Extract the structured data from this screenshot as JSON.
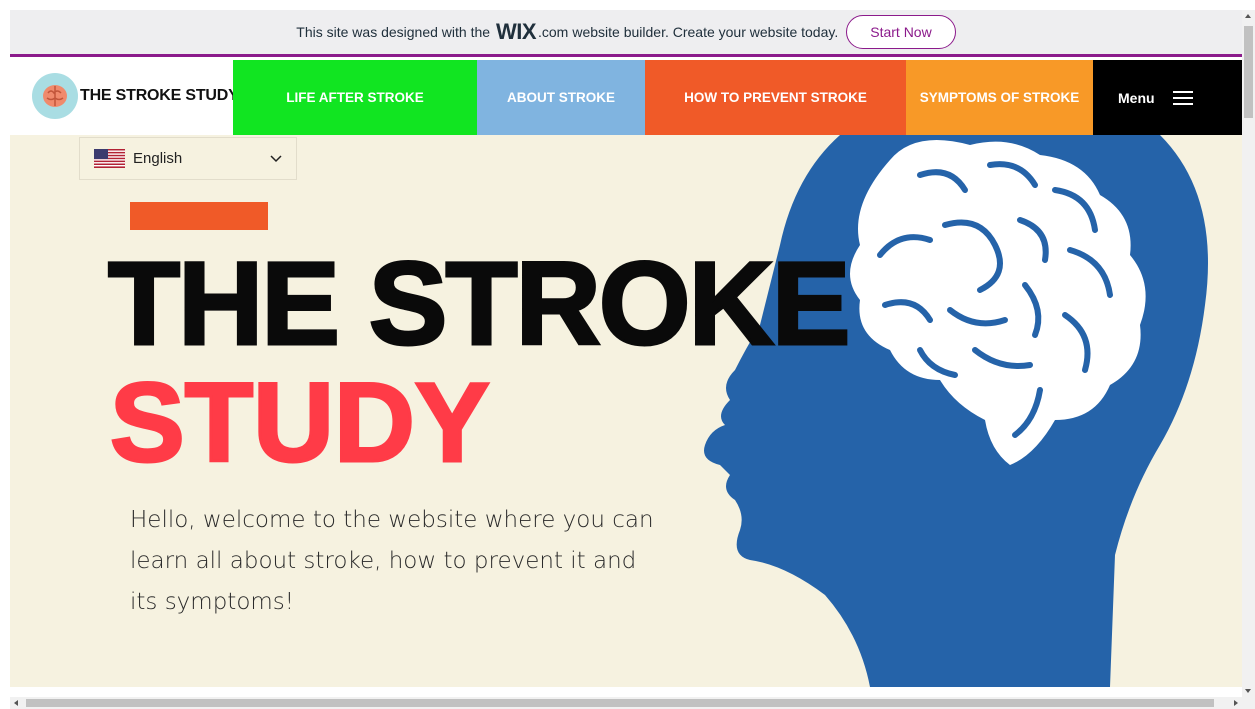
{
  "wix_banner": {
    "text_before": "This site was designed with the",
    "logo": "WIX",
    "logo_suffix": ".com",
    "text_after": "website builder. Create your website today.",
    "button_label": "Start Now",
    "accent_color": "#8b1a8b"
  },
  "header": {
    "brand_name": "THE STROKE STUDY",
    "brand_logo_icon": "brain-icon",
    "nav": [
      {
        "label": "LIFE AFTER STROKE",
        "color": "#11e521"
      },
      {
        "label": "ABOUT STROKE",
        "color": "#80b4e0"
      },
      {
        "label": "HOW TO PREVENT STROKE",
        "color": "#f05a28"
      },
      {
        "label": "SYMPTOMS OF STROKE",
        "color": "#f89927"
      }
    ],
    "menu_label": "Menu",
    "menu_icon": "hamburger-icon"
  },
  "language_selector": {
    "selected": "English",
    "flag_icon": "us-flag-icon"
  },
  "hero": {
    "title_line1": "THE STROKE",
    "title_line2": "STUDY",
    "intro": "Hello, welcome to the website where you can learn all about stroke, how to prevent it and its symptoms!",
    "image_icon": "head-brain-illustration",
    "background": "#f6f2e0",
    "title_accent": "#ff3b47",
    "head_color": "#2563a9"
  }
}
